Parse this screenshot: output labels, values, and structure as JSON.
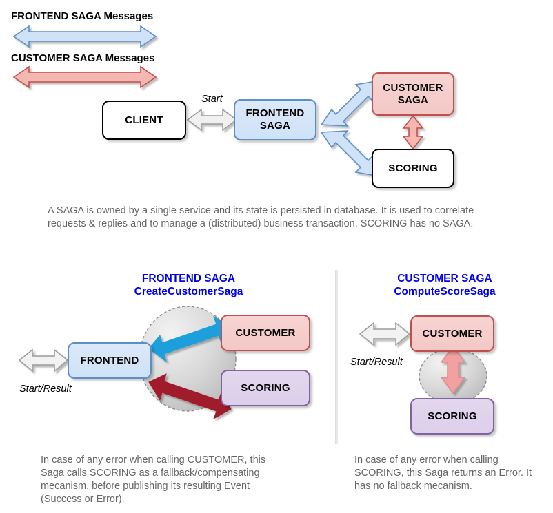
{
  "legend": {
    "items": [
      {
        "label": "FRONTEND SAGA Messages",
        "color": "#cfe2f7",
        "stroke": "#5b8fc9",
        "icon": "double-arrow-icon"
      },
      {
        "label": "CUSTOMER SAGA Messages",
        "color": "#f5b7b1",
        "stroke": "#c0504d",
        "icon": "double-arrow-icon"
      }
    ]
  },
  "overview": {
    "nodes": {
      "client": "CLIENT",
      "frontend_saga": "FRONTEND\nSAGA",
      "frontend_saga_line1": "FRONTEND",
      "frontend_saga_line2": "SAGA",
      "customer_saga_line1": "CUSTOMER",
      "customer_saga_line2": "SAGA",
      "scoring": "SCORING"
    },
    "edge_labels": {
      "start": "Start"
    },
    "description": "A SAGA is owned by a single service and its state is persisted in database. It is used to correlate requests & replies and to manage a (distributed) business transaction. SCORING has no SAGA."
  },
  "panels": [
    {
      "title_line1": "FRONTEND SAGA",
      "title_line2": "CreateCustomerSaga",
      "entry_label": "Start/Result",
      "nodes": {
        "main": "FRONTEND",
        "upper": "CUSTOMER",
        "lower": "SCORING"
      },
      "arrow_colors": {
        "upper": "#1f9fdb",
        "lower": "#a01b2c"
      },
      "caption": "In case of any error when calling CUSTOMER, this Saga calls SCORING as a fallback/compensating mecanism, before publishing its resulting Event (Success or Error)."
    },
    {
      "title_line1": "CUSTOMER SAGA",
      "title_line2": "ComputeScoreSaga",
      "entry_label": "Start/Result",
      "nodes": {
        "upper": "CUSTOMER",
        "lower": "SCORING"
      },
      "arrow_colors": {
        "vertical": "#f2a0a0"
      },
      "caption": "In case of any error when calling SCORING, this Saga returns an Error. It has no fallback mecanism."
    }
  ],
  "colors": {
    "saga_blue": "#cfe2f7",
    "saga_red": "#f3c8c6",
    "scoring_purple": "#ddcfea",
    "heading_blue": "#0000ee",
    "body_gray": "#666666",
    "circle_gray": "#c9c9c9"
  }
}
